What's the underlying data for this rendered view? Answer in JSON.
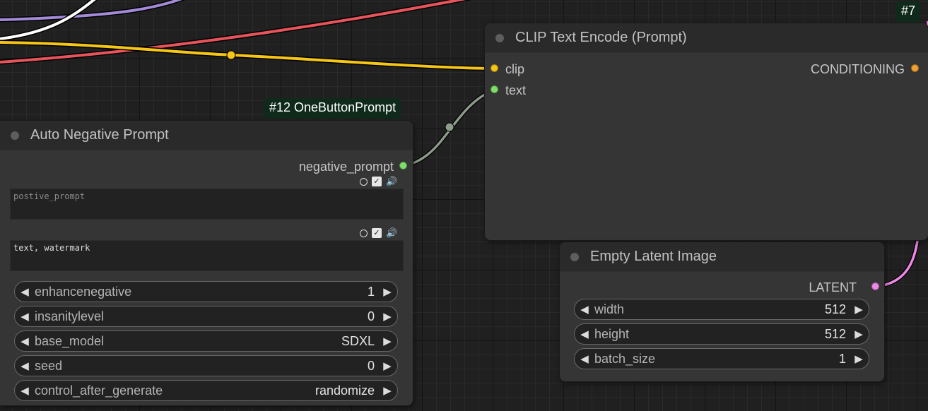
{
  "colors": {
    "clip": "#f5c518",
    "string": "#7ee067",
    "conditioning": "#f0a032",
    "latent": "#ee88e6",
    "red_link": "#e8545c",
    "purple_link": "#a48ad8",
    "white_link": "#ffffff",
    "string_link": "#8c9b8a"
  },
  "clip_node": {
    "badge": "#7",
    "title": "CLIP Text Encode (Prompt)",
    "inputs": [
      "clip",
      "text"
    ],
    "output": "CONDITIONING"
  },
  "auto_neg_node": {
    "badge": "#12 OneButtonPrompt",
    "title": "Auto Negative Prompt",
    "output": "negative_prompt",
    "textarea1_placeholder": "postive_prompt",
    "textarea2_value": "text, watermark",
    "check_icon": "✓",
    "widgets": [
      {
        "label": "enhancenegative",
        "value": "1"
      },
      {
        "label": "insanitylevel",
        "value": "0"
      },
      {
        "label": "base_model",
        "value": "SDXL"
      },
      {
        "label": "seed",
        "value": "0"
      },
      {
        "label": "control_after_generate",
        "value": "randomize"
      }
    ]
  },
  "latent_node": {
    "title": "Empty Latent Image",
    "output": "LATENT",
    "widgets": [
      {
        "label": "width",
        "value": "512"
      },
      {
        "label": "height",
        "value": "512"
      },
      {
        "label": "batch_size",
        "value": "1"
      }
    ]
  },
  "glyphs": {
    "arrow_left": "◀",
    "arrow_right": "▶",
    "speaker": "🔊"
  }
}
